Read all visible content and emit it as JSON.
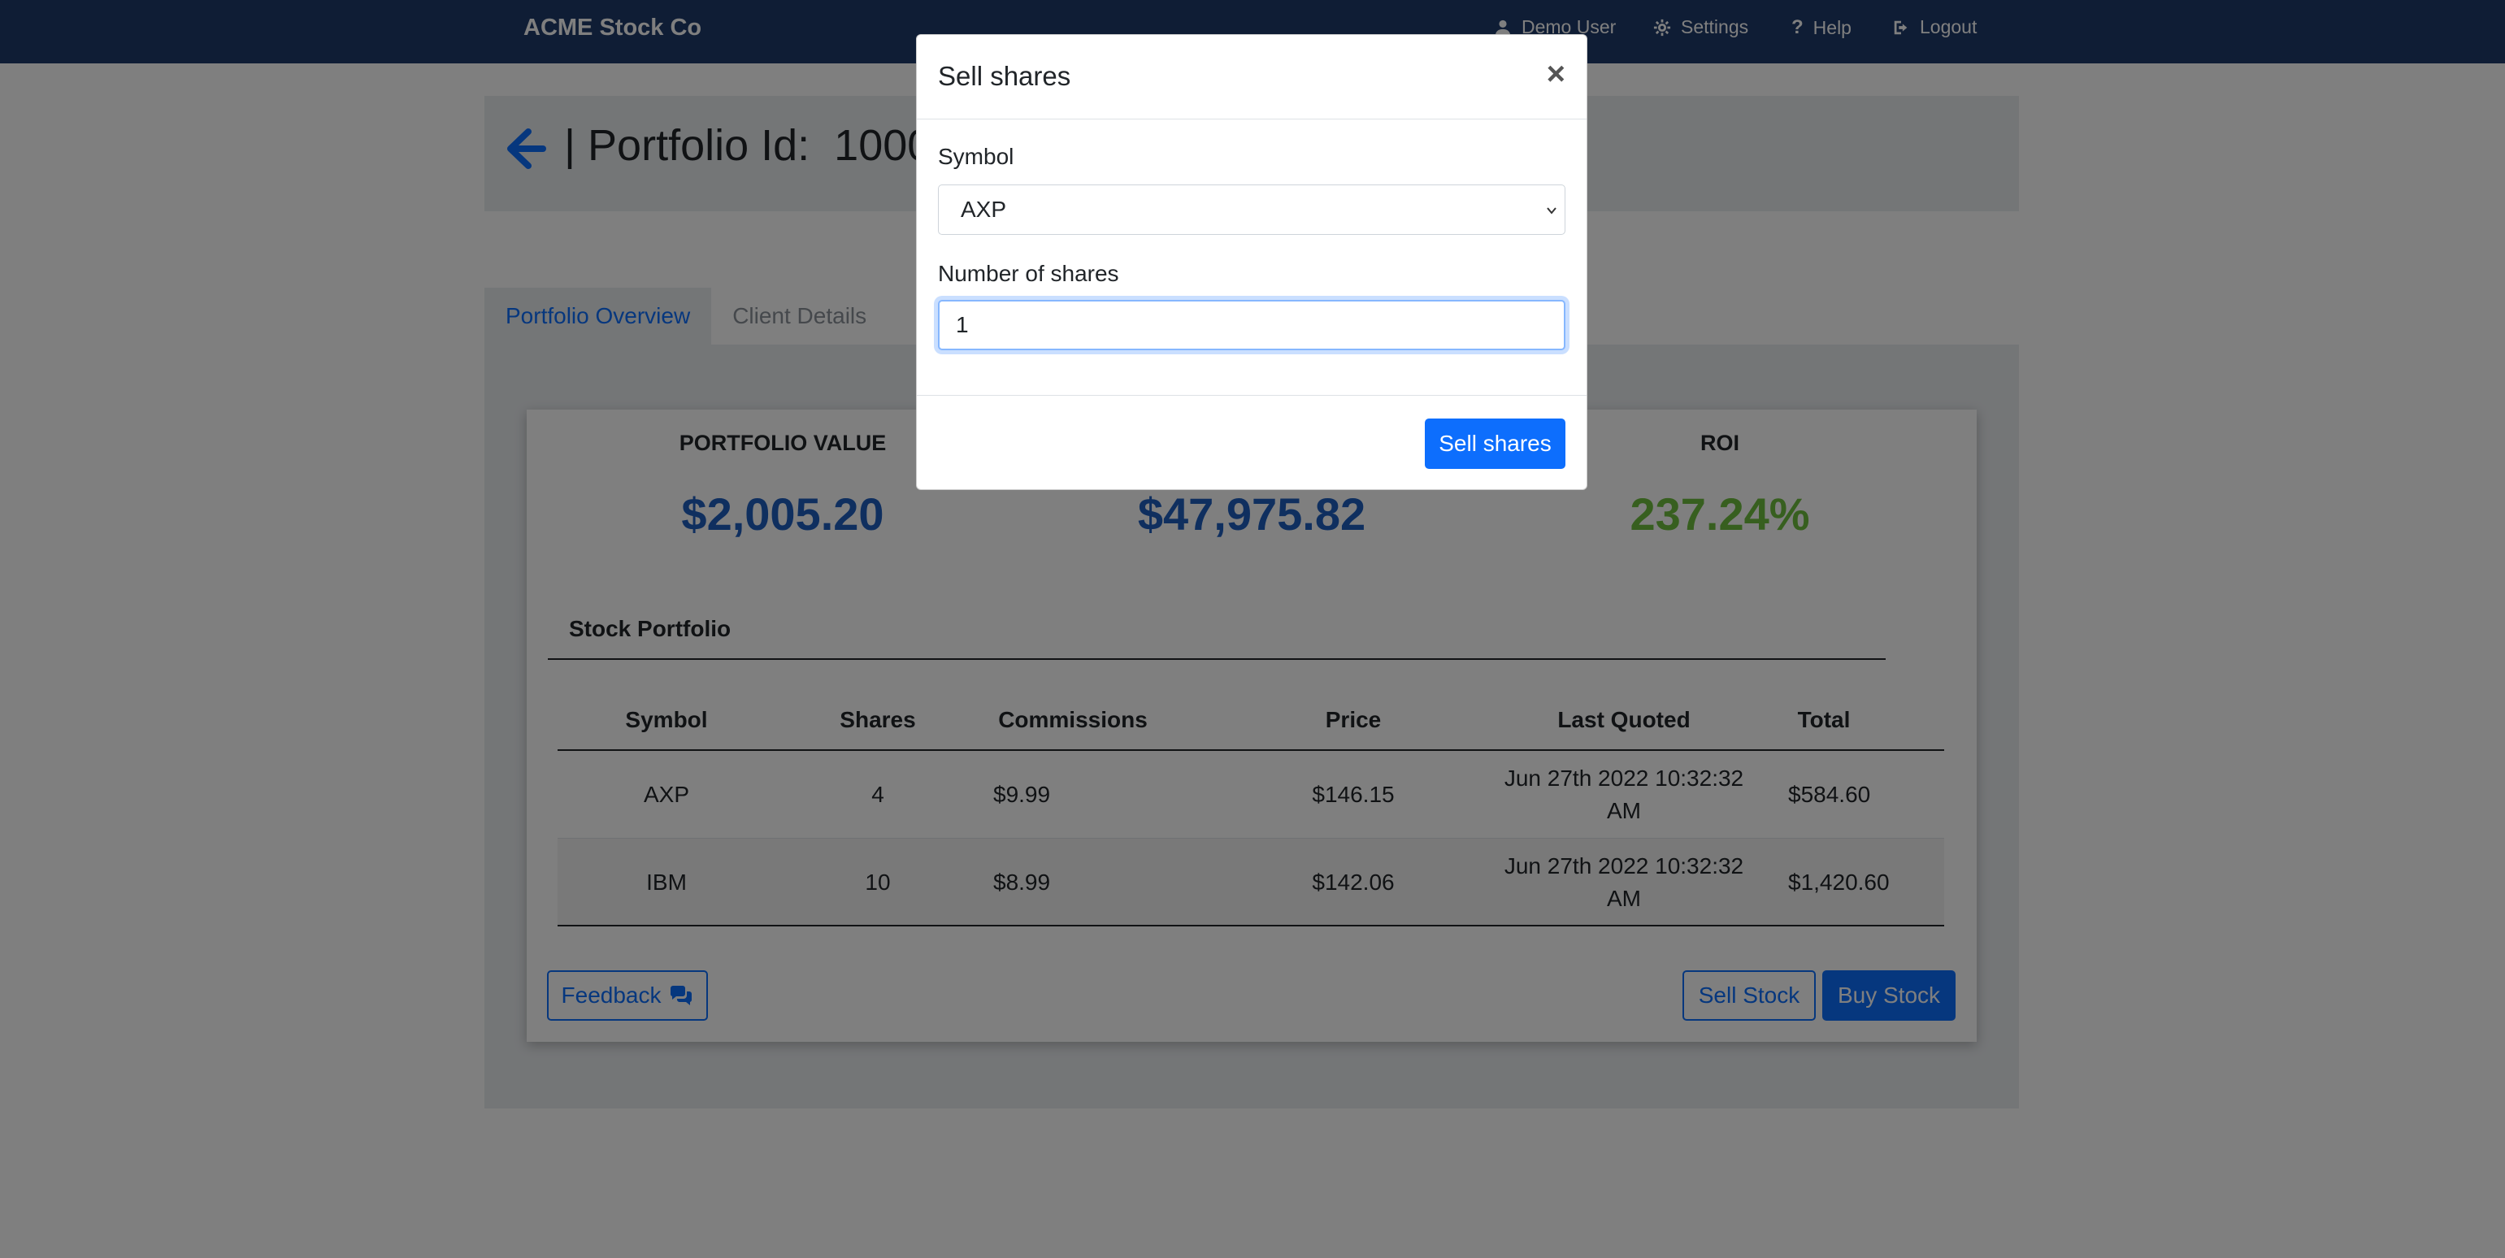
{
  "navbar": {
    "brand": "ACME Stock Co",
    "user": "Demo User",
    "settings": "Settings",
    "help": "Help",
    "logout": "Logout"
  },
  "header": {
    "title": "| Portfolio Id:  1000"
  },
  "tabs": [
    {
      "label": "Portfolio Overview",
      "active": true
    },
    {
      "label": "Client Details",
      "active": false
    }
  ],
  "stats": {
    "portfolio_value_label": "PORTFOLIO VALUE",
    "portfolio_value": "$2,005.20",
    "middle_value": "$47,975.82",
    "roi_label": "ROI",
    "roi_value": "237.24%"
  },
  "portfolio": {
    "title": "Stock Portfolio",
    "columns": [
      "Symbol",
      "Shares",
      "Commissions",
      "Price",
      "Last Quoted",
      "Total"
    ],
    "rows": [
      {
        "symbol": "AXP",
        "shares": "4",
        "commissions": "$9.99",
        "price": "$146.15",
        "last_quoted_1": "Jun 27th 2022 10:32:32",
        "last_quoted_2": "AM",
        "total": "$584.60"
      },
      {
        "symbol": "IBM",
        "shares": "10",
        "commissions": "$8.99",
        "price": "$142.06",
        "last_quoted_1": "Jun 27th 2022 10:32:32",
        "last_quoted_2": "AM",
        "total": "$1,420.60"
      }
    ]
  },
  "buttons": {
    "feedback": "Feedback",
    "sell_stock": "Sell Stock",
    "buy_stock": "Buy Stock"
  },
  "modal": {
    "title": "Sell shares",
    "close": "×",
    "symbol_label": "Symbol",
    "symbol_value": "AXP",
    "shares_label": "Number of shares",
    "shares_value": "1",
    "submit": "Sell shares"
  },
  "colors": {
    "navbar": "#1f3a6b",
    "accent": "#0d6efd",
    "value_blue": "#1f5fbf",
    "roi_green": "#6fbf3f"
  }
}
